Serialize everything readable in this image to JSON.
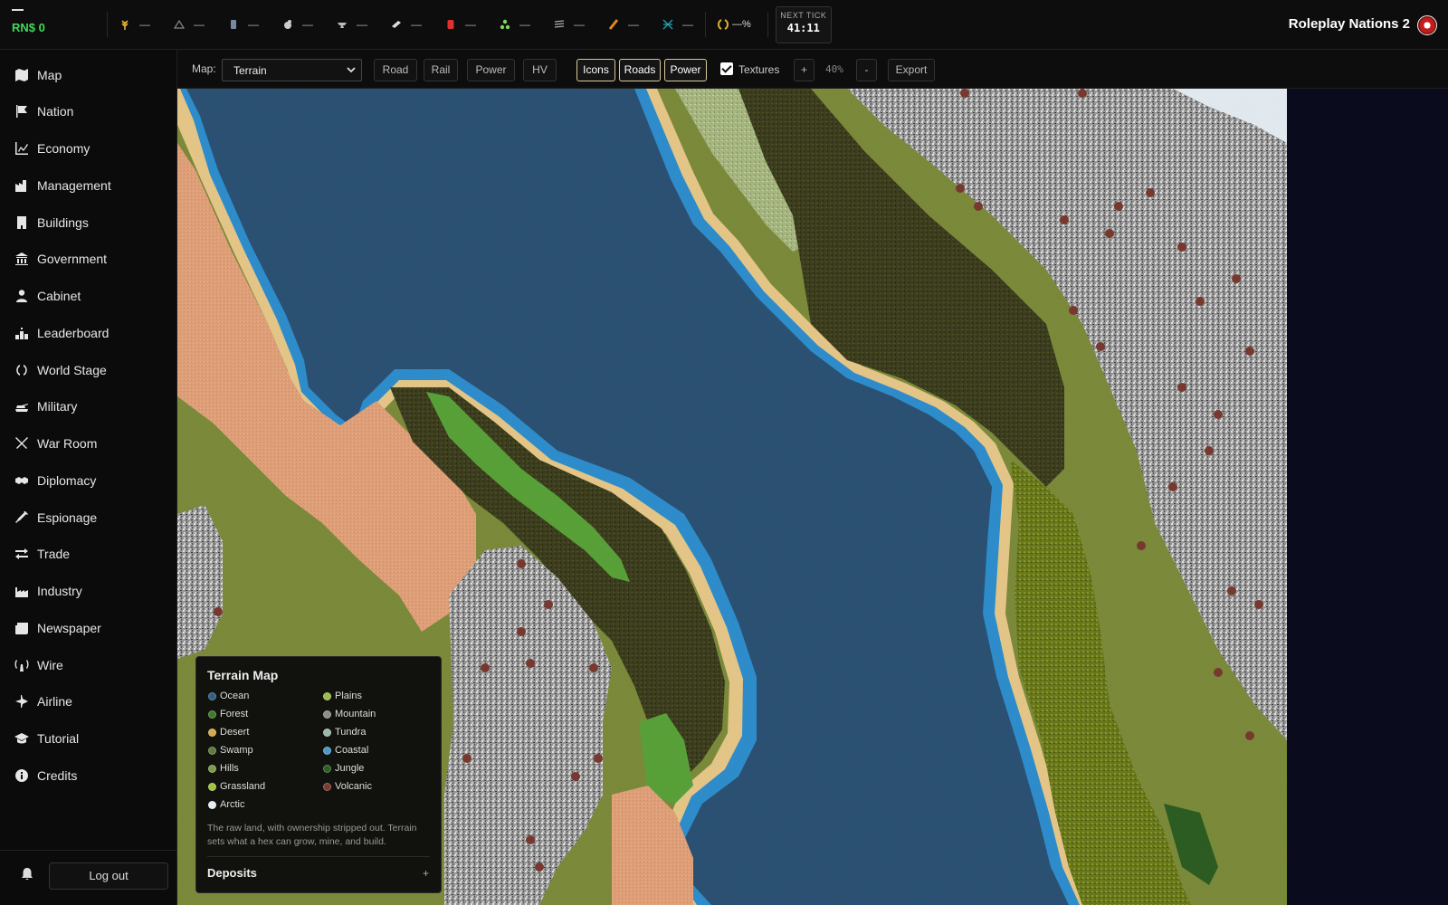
{
  "topbar": {
    "money": "RN$ 0",
    "resources": [
      {
        "icon": "wheat-icon",
        "value": "—",
        "color": "#e0b030"
      },
      {
        "icon": "lumber-icon",
        "value": "—",
        "color": "#888888"
      },
      {
        "icon": "steel-icon",
        "value": "—",
        "color": "#7a87a0"
      },
      {
        "icon": "coal-icon",
        "value": "—",
        "color": "#cccccc"
      },
      {
        "icon": "anvil-icon",
        "value": "—",
        "color": "#bbbbbb"
      },
      {
        "icon": "aluminum-icon",
        "value": "—",
        "color": "#dddddd"
      },
      {
        "icon": "oil-barrel-icon",
        "value": "—",
        "color": "#e03030"
      },
      {
        "icon": "uranium-icon",
        "value": "—",
        "color": "#7ed957"
      },
      {
        "icon": "cable-icon",
        "value": "—",
        "color": "#aaaaaa"
      },
      {
        "icon": "copper-icon",
        "value": "—",
        "color": "#e08a20"
      },
      {
        "icon": "fiber-icon",
        "value": "—",
        "color": "#20a0b0"
      }
    ],
    "approval": "—%",
    "next_tick_label": "NEXT TICK",
    "next_tick_time": "41:11",
    "brand": "Roleplay Nations 2"
  },
  "sidebar": {
    "items": [
      {
        "label": "Map",
        "icon": "map-icon"
      },
      {
        "label": "Nation",
        "icon": "flag-icon"
      },
      {
        "label": "Economy",
        "icon": "chart-line-icon"
      },
      {
        "label": "Management",
        "icon": "factory-icon"
      },
      {
        "label": "Buildings",
        "icon": "building-icon"
      },
      {
        "label": "Government",
        "icon": "landmark-icon"
      },
      {
        "label": "Cabinet",
        "icon": "person-tie-icon"
      },
      {
        "label": "Leaderboard",
        "icon": "ranking-icon"
      },
      {
        "label": "World Stage",
        "icon": "laurel-icon"
      },
      {
        "label": "Military",
        "icon": "tank-icon"
      },
      {
        "label": "War Room",
        "icon": "crossed-swords-icon"
      },
      {
        "label": "Diplomacy",
        "icon": "handshake-icon"
      },
      {
        "label": "Espionage",
        "icon": "syringe-icon"
      },
      {
        "label": "Trade",
        "icon": "exchange-icon"
      },
      {
        "label": "Industry",
        "icon": "industry-icon"
      },
      {
        "label": "Newspaper",
        "icon": "newspaper-icon"
      },
      {
        "label": "Wire",
        "icon": "antenna-icon"
      },
      {
        "label": "Airline",
        "icon": "plane-icon"
      },
      {
        "label": "Tutorial",
        "icon": "graduation-cap-icon"
      },
      {
        "label": "Credits",
        "icon": "info-icon"
      }
    ],
    "logout": "Log out"
  },
  "toolbar": {
    "map_label": "Map:",
    "map_select": "Terrain",
    "layer_buttons": [
      "Road",
      "Rail",
      "Power",
      "HV"
    ],
    "toggle_buttons": [
      "Icons",
      "Roads",
      "Power"
    ],
    "textures_label": "Textures",
    "textures_checked": true,
    "zoom_in": "+",
    "zoom_level": "40%",
    "zoom_out": "-",
    "export": "Export"
  },
  "legend": {
    "title": "Terrain Map",
    "items": [
      {
        "label": "Ocean",
        "color": "#2f5f85"
      },
      {
        "label": "Plains",
        "color": "#9bbb4c"
      },
      {
        "label": "Forest",
        "color": "#3f7a2a"
      },
      {
        "label": "Mountain",
        "color": "#8c8c8c"
      },
      {
        "label": "Desert",
        "color": "#d6a94a"
      },
      {
        "label": "Tundra",
        "color": "#9cb8a8"
      },
      {
        "label": "Swamp",
        "color": "#5e7a3e"
      },
      {
        "label": "Coastal",
        "color": "#4e98c8"
      },
      {
        "label": "Hills",
        "color": "#7d9a4a"
      },
      {
        "label": "Jungle",
        "color": "#2d5e22"
      },
      {
        "label": "Grassland",
        "color": "#a3c23c"
      },
      {
        "label": "Volcanic",
        "color": "#7a3a30"
      },
      {
        "label": "Arctic",
        "color": "#e6eef4"
      }
    ],
    "description": "The raw land, with ownership stripped out. Terrain sets what a hex can grow, mine, and build.",
    "deposits_label": "Deposits",
    "deposits_toggle": "+"
  },
  "colors": {
    "accent": "#d9c89b",
    "money": "#3ddc55",
    "ocean": "#2c5275",
    "coast_hex": "#2f8fcf",
    "beach": "#e8c98a"
  }
}
